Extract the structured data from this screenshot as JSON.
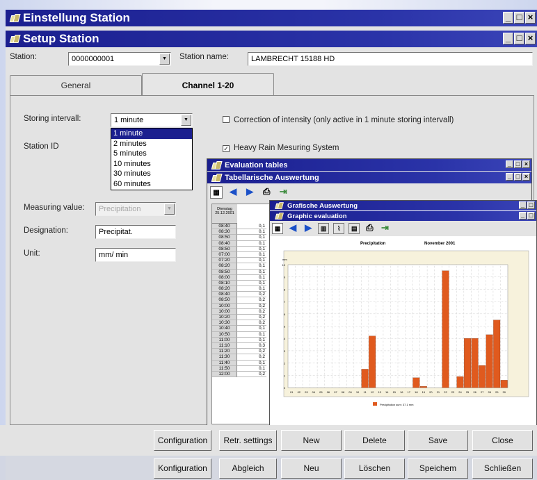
{
  "window1": {
    "title": "Einstellung Station"
  },
  "window2": {
    "title": "Setup Station"
  },
  "station": {
    "label": "Station:",
    "value": "0000000001",
    "name_label": "Station name:",
    "name_value": "LAMBRECHT 15188 HD"
  },
  "tabs": [
    {
      "label": "General"
    },
    {
      "label": "Channel 1-20"
    }
  ],
  "storing": {
    "label": "Storing intervall:",
    "value": "1  minute",
    "options": [
      "1  minute",
      "2  minutes",
      "5  minutes",
      "10 minutes",
      "30 minutes",
      "60 minutes"
    ]
  },
  "station_id": {
    "label": "Station ID"
  },
  "correction": {
    "label": "Correction of intensity (only active in 1 minute storing intervall)",
    "checked": false
  },
  "heavy_rain": {
    "label": "Heavy Rain Mesuring System",
    "checked": true
  },
  "measuring": {
    "label": "Measuring value:",
    "value": "Precipitation"
  },
  "designation": {
    "label": "Designation:",
    "value": "Precipitat."
  },
  "unit": {
    "label": "Unit:",
    "value": "mm/ min"
  },
  "eval_window": {
    "title1": "Evaluation tables",
    "title2": "Tabellarische Auswertung"
  },
  "table": {
    "header1": "Dienstag",
    "header2": "25.12.2001",
    "times": [
      "08:40",
      "08:30",
      "08:50",
      "08:40",
      "08:50",
      "07:00",
      "07:20",
      "08:20",
      "08:50",
      "08:00",
      "08:10",
      "08:20",
      "08:40",
      "08:50",
      "10:00",
      "10:00",
      "10:20",
      "10:30",
      "10:40",
      "10:50",
      "11:00",
      "11:10",
      "11:20",
      "11:30",
      "11:40",
      "11:50",
      "12:00"
    ],
    "values": [
      "0,1",
      "0,1",
      "0,1",
      "0,1",
      "0,1",
      "0,1",
      "0,1",
      "0,1",
      "0,1",
      "0,1",
      "0,1",
      "0,1",
      "0,2",
      "0,2",
      "0,2",
      "0,2",
      "0,2",
      "0,2",
      "0,1",
      "0,1",
      "0,1",
      "0,3",
      "0,2",
      "0,2",
      "0,1",
      "0,1",
      "0,2"
    ]
  },
  "graphic_window": {
    "title1": "Grafische Auswertung",
    "title2": "Graphic evaluation"
  },
  "chart_data": {
    "type": "bar",
    "title": "Precipitation",
    "subtitle": "November 2001",
    "ylabel": "mm",
    "ylim": [
      0,
      10
    ],
    "categories": [
      "01",
      "02",
      "03",
      "04",
      "05",
      "06",
      "07",
      "08",
      "09",
      "10",
      "11",
      "12",
      "13",
      "14",
      "15",
      "16",
      "17",
      "18",
      "19",
      "20",
      "21",
      "22",
      "23",
      "24",
      "25",
      "26",
      "27",
      "28",
      "29",
      "30"
    ],
    "values": [
      0,
      0,
      0,
      0,
      0,
      0,
      0,
      0,
      0,
      0,
      1.5,
      4.2,
      0,
      0,
      0,
      0,
      0,
      0.8,
      0.1,
      0,
      0,
      9.5,
      0,
      0.9,
      4.0,
      4.0,
      1.8,
      4.3,
      5.5,
      0.6
    ],
    "legend": "Precipitation sum: 37.1 mm",
    "bar_color": "#e05a1e",
    "bg_color": "#f7f2dc",
    "grid": true
  },
  "buttons_en": [
    "Configuration",
    "Retr. settings",
    "New",
    "Delete",
    "Save",
    "Close"
  ],
  "buttons_de": [
    "Konfiguration",
    "Abgleich",
    "Neu",
    "Löschen",
    "Speichem",
    "Schließen"
  ],
  "win_controls": {
    "min": "_",
    "max": "□",
    "close": "×"
  }
}
